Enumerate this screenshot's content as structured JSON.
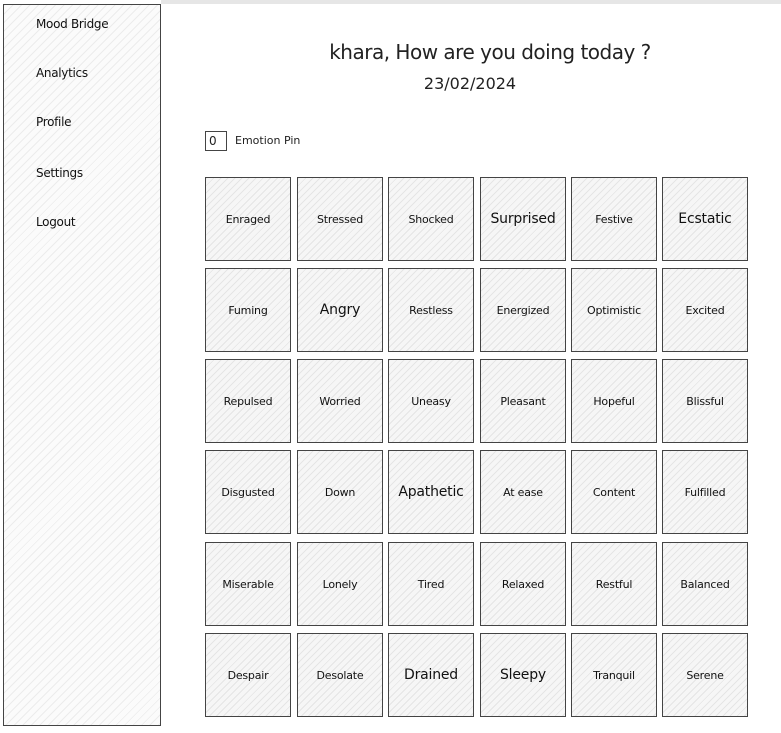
{
  "app": {
    "brand": "Mood Bridge"
  },
  "sidebar": {
    "items": [
      {
        "label": "Analytics"
      },
      {
        "label": "Profile"
      },
      {
        "label": "Settings"
      },
      {
        "label": "Logout"
      }
    ]
  },
  "header": {
    "greeting": "khara, How are you doing today ?",
    "date": "23/02/2024"
  },
  "pin": {
    "value": "0",
    "label": "Emotion Pin"
  },
  "emotions": [
    [
      "Enraged",
      "Stressed",
      "Shocked",
      "Surprised",
      "Festive",
      "Ecstatic"
    ],
    [
      "Fuming",
      "Angry",
      "Restless",
      "Energized",
      "Optimistic",
      "Excited"
    ],
    [
      "Repulsed",
      "Worried",
      "Uneasy",
      "Pleasant",
      "Hopeful",
      "Blissful"
    ],
    [
      "Disgusted",
      "Down",
      "Apathetic",
      "At ease",
      "Content",
      "Fulfilled"
    ],
    [
      "Miserable",
      "Lonely",
      "Tired",
      "Relaxed",
      "Restful",
      "Balanced"
    ],
    [
      "Despair",
      "Desolate",
      "Drained",
      "Sleepy",
      "Tranquil",
      "Serene"
    ]
  ]
}
